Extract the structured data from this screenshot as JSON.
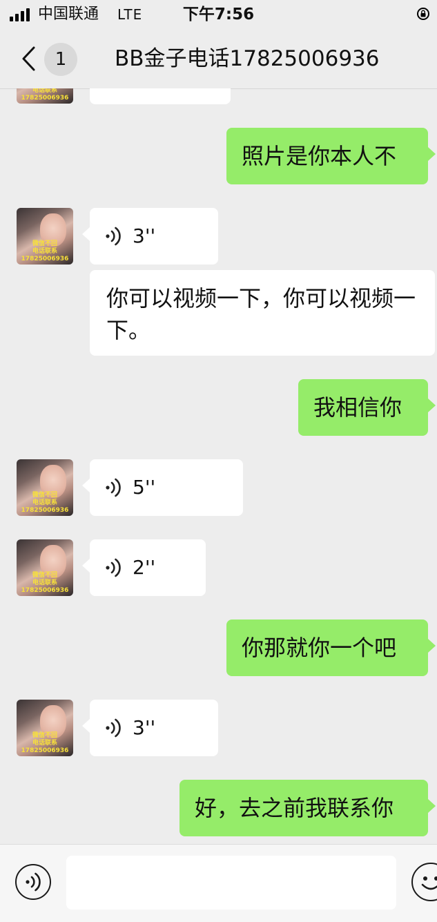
{
  "status_bar": {
    "carrier": "中国联通",
    "network": "LTE",
    "time": "下午7:56"
  },
  "nav": {
    "unread_count": "1",
    "title": "BB金子电话17825006936"
  },
  "avatar_watermark": {
    "line1": "微信不回",
    "line2": "电话联系",
    "line3": "17825006936"
  },
  "messages": [
    {
      "side": "incoming",
      "type": "text",
      "text": ""
    },
    {
      "side": "outgoing",
      "type": "text",
      "text": "照片是你本人不"
    },
    {
      "side": "incoming",
      "type": "voice",
      "duration": "3''"
    },
    {
      "side": "incoming",
      "type": "text",
      "text": "你可以视频一下，你可以视频一下。"
    },
    {
      "side": "outgoing",
      "type": "text",
      "text": "我相信你"
    },
    {
      "side": "incoming",
      "type": "voice",
      "duration": "5''"
    },
    {
      "side": "incoming",
      "type": "voice",
      "duration": "2''"
    },
    {
      "side": "outgoing",
      "type": "text",
      "text": "你那就你一个吧"
    },
    {
      "side": "incoming",
      "type": "voice",
      "duration": "3''"
    },
    {
      "side": "outgoing",
      "type": "text",
      "text": "好，去之前我联系你"
    }
  ],
  "input_bar": {
    "message_value": "",
    "voice_icon": "voice-icon",
    "emoji_icon": "emoji-icon"
  },
  "colors": {
    "background": "#ededed",
    "incoming_bubble": "#ffffff",
    "outgoing_bubble": "#95ec69",
    "watermark": "#f7e03a"
  }
}
